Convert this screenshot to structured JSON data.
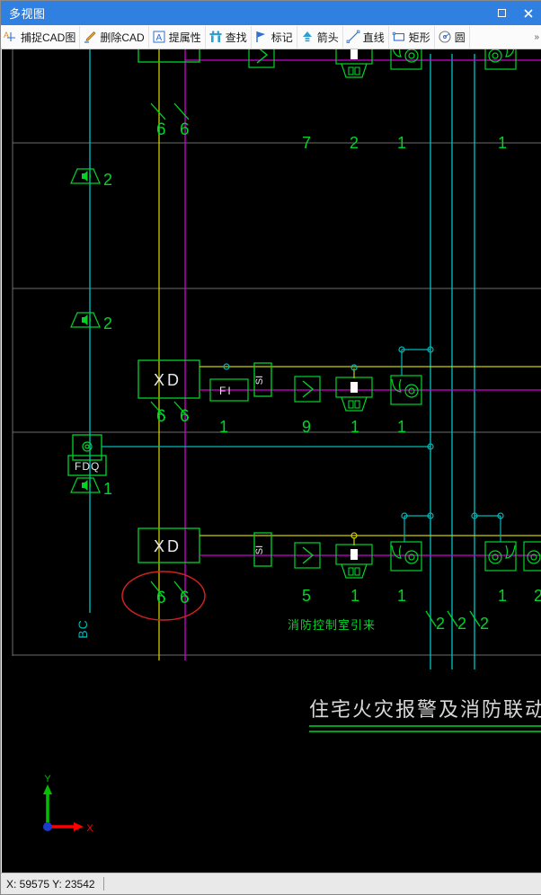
{
  "window": {
    "title": "多视图",
    "maximize_label": "□",
    "close_label": "✕"
  },
  "toolbar": {
    "overflow_label": "»",
    "items": [
      {
        "label": "捕捉CAD图",
        "icon": "capture-cad-icon"
      },
      {
        "label": "删除CAD",
        "icon": "delete-cad-icon"
      },
      {
        "label": "提属性",
        "icon": "extract-attribute-icon"
      },
      {
        "label": "查找",
        "icon": "find-icon"
      },
      {
        "label": "标记",
        "icon": "mark-flag-icon"
      },
      {
        "label": "箭头",
        "icon": "arrow-up-icon"
      },
      {
        "label": "直线",
        "icon": "line-icon"
      },
      {
        "label": "矩形",
        "icon": "rectangle-icon"
      },
      {
        "label": "圆",
        "icon": "circle-icon"
      }
    ]
  },
  "statusbar": {
    "coords": "X: 59575  Y: 23542"
  },
  "drawing": {
    "title": "住宅火灾报警及消防联动系统图",
    "annotation_from_control_room": "消防控制室引来",
    "bus_label": "BC",
    "colors": {
      "background": "#000000",
      "green": "#00d427",
      "magenta": "#d400d4",
      "yellow": "#cccc00",
      "cyan": "#00b8b8",
      "frame_gray": "#6e6e6e",
      "red_markup": "#cc2222",
      "white_text": "#e8e8e8",
      "ucs_x": "#ff0000",
      "ucs_y": "#00c000",
      "ucs_origin": "#1a3ccc"
    },
    "modules": [
      {
        "label": "XD",
        "row": 2
      },
      {
        "label": "XD",
        "row": 3
      }
    ],
    "blocks": [
      {
        "label": "FI",
        "row": 2
      },
      {
        "label": "FDQ",
        "row": 2
      },
      {
        "label": "SI",
        "row": 2,
        "rotated": true
      },
      {
        "label": "SI",
        "row": 3,
        "rotated": true
      }
    ],
    "riser_counts_top": [
      "6",
      "6"
    ],
    "riser_counts_mid": [
      "6",
      "6"
    ],
    "riser_counts_bottom": [
      "6",
      "6"
    ],
    "bottom_riser_counts": [
      "2",
      "2",
      "2"
    ],
    "device_counts": {
      "row1": [
        "2",
        "7",
        "2",
        "1",
        "1"
      ],
      "row_gap": [
        "2"
      ],
      "row2": [
        "2",
        "1",
        "9",
        "1",
        "1"
      ],
      "row3": [
        "1",
        "5",
        "1",
        "1",
        "1",
        "2"
      ]
    },
    "device_types": {
      "horn": "horn-speaker-symbol",
      "manual_station": "manual-call-point-symbol",
      "module": "control-module-symbol",
      "detector": "smoke-detector-symbol",
      "sounder_strobe": "sounder-strobe-symbol"
    }
  }
}
